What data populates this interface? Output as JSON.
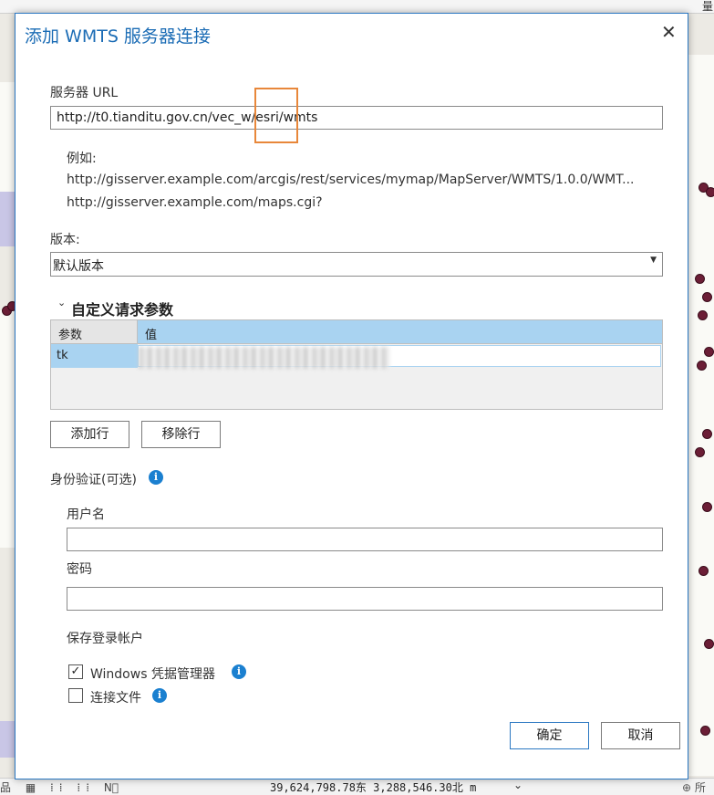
{
  "background": {
    "top_right_label": "量",
    "status_bar": {
      "coordinates": "39,624,798.78东 3,288,546.30北 m",
      "left_icons": "品 ▦ ⁞⁞ ⁞⁞ N⃒",
      "chevron": "⌄",
      "right_label": "⊕ 所"
    }
  },
  "dialog": {
    "title": "添加 WMTS 服务器连接",
    "close_glyph": "✕",
    "server_url": {
      "label": "服务器 URL",
      "value": "http://t0.tianditu.gov.cn/vec_w/esri/wmts"
    },
    "example": {
      "label": "例如:",
      "line1": "http://gisserver.example.com/arcgis/rest/services/mymap/MapServer/WMTS/1.0.0/WMT...",
      "line2": "http://gisserver.example.com/maps.cgi?"
    },
    "version": {
      "label": "版本:",
      "selected": "默认版本",
      "arrow": "▼"
    },
    "custom_params": {
      "chevron": "⌄",
      "title": "自定义请求参数",
      "headers": {
        "param": "参数",
        "value": "值"
      },
      "rows": [
        {
          "param": "tk",
          "value": ""
        }
      ]
    },
    "buttons": {
      "add_row": "添加行",
      "remove_row": "移除行",
      "ok": "确定",
      "cancel": "取消"
    },
    "auth": {
      "label": "身份验证(可选)",
      "info_glyph": "i",
      "username_label": "用户名",
      "password_label": "密码",
      "username_value": "",
      "password_value": ""
    },
    "save_login": {
      "label": "保存登录帐户",
      "windows_cred": {
        "label": "Windows 凭据管理器",
        "checked": true,
        "check_glyph": "✓"
      },
      "conn_file": {
        "label": "连接文件",
        "checked": false
      }
    }
  },
  "colors": {
    "accent": "#1b6cb5",
    "highlight_box": "#e8873a",
    "grid_selection": "#a9d3f1",
    "map_dots": "#6b1e36"
  }
}
